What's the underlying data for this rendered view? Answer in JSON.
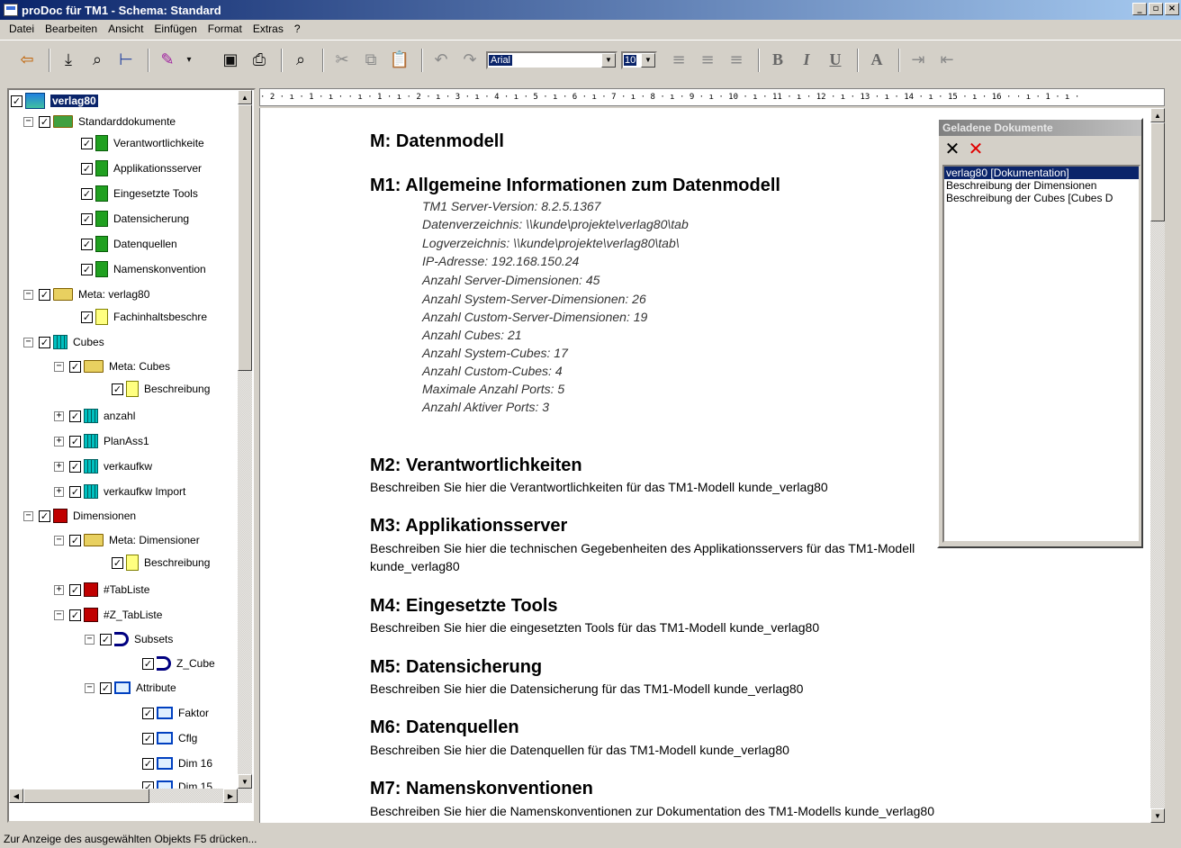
{
  "window": {
    "title": "proDoc für TM1 - Schema: Standard"
  },
  "menu": [
    "Datei",
    "Bearbeiten",
    "Ansicht",
    "Einfügen",
    "Format",
    "Extras",
    "?"
  ],
  "menu_ul": [
    "D",
    "B",
    "A",
    "E",
    "t",
    "x",
    "?"
  ],
  "toolbar": {
    "font": "Arial",
    "size": "10"
  },
  "tree": {
    "root": "verlag80",
    "standarddokumente": "Standarddokumente",
    "std_items": [
      "Verantwortlichkeite",
      "Applikationsserver",
      "Eingesetzte Tools",
      "Datensicherung",
      "Datenquellen",
      "Namenskonvention"
    ],
    "meta_verlag": "Meta: verlag80",
    "fachinhalt": "Fachinhaltsbeschre",
    "cubes": "Cubes",
    "meta_cubes": "Meta: Cubes",
    "beschreibung1": "Beschreibung",
    "cube_items": [
      "anzahl",
      "PlanAss1",
      "verkaufkw",
      "verkaufkw Import"
    ],
    "dimensionen": "Dimensionen",
    "meta_dims": "Meta: Dimensioner",
    "beschreibung2": "Beschreibung",
    "tabliste": "#TabListe",
    "z_tabliste": "#Z_TabListe",
    "subsets": "Subsets",
    "z_cube": "Z_Cube",
    "attribute": "Attribute",
    "attr_items": [
      "Faktor",
      "Cflg",
      "Dim 16",
      "Dim 15"
    ]
  },
  "ruler": "· 2 · ı · 1 · ı ·  · ı · 1 · ı · 2 · ı · 3 · ı · 4 · ı · 5 · ı · 6 · ı · 7 · ı · 8 · ı · 9 · ı · 10 · ı · 11 · ı · 12 · ı · 13 · ı · 14 · ı · 15 · ı · 16 ·   · ı · 1 · ı · ",
  "document": {
    "m": "M: Datenmodell",
    "m1": "M1: Allgemeine Informationen zum Datenmodell",
    "info": [
      "TM1 Server-Version: 8.2.5.1367",
      "Datenverzeichnis: \\\\kunde\\projekte\\verlag80\\tab",
      "Logverzeichnis: \\\\kunde\\projekte\\verlag80\\tab\\",
      "IP-Adresse: 192.168.150.24",
      "Anzahl Server-Dimensionen: 45",
      "Anzahl System-Server-Dimensionen: 26",
      "Anzahl Custom-Server-Dimensionen: 19",
      "Anzahl Cubes: 21",
      "Anzahl System-Cubes: 17",
      "Anzahl Custom-Cubes: 4",
      "Maximale Anzahl Ports: 5",
      "Anzahl Aktiver Ports: 3"
    ],
    "m2": "M2: Verantwortlichkeiten",
    "m2_text": "Beschreiben Sie hier die Verantwortlichkeiten für das TM1-Modell kunde_verlag80",
    "m3": "M3: Applikationsserver",
    "m3_text": "Beschreiben Sie hier die technischen Gegebenheiten des Applikationsservers für das TM1-Modell",
    "m3_text2": "kunde_verlag80",
    "m4": "M4: Eingesetzte Tools",
    "m4_text": "Beschreiben Sie hier die eingesetzten Tools für das TM1-Modell kunde_verlag80",
    "m5": "M5: Datensicherung",
    "m5_text": "Beschreiben Sie hier die Datensicherung für das TM1-Modell kunde_verlag80",
    "m6": "M6: Datenquellen",
    "m6_text": "Beschreiben Sie hier die Datenquellen für das TM1-Modell kunde_verlag80",
    "m7": "M7: Namenskonventionen",
    "m7_text": "Beschreiben Sie hier die Namenskonventionen zur Dokumentation des TM1-Modells kunde_verlag80"
  },
  "loaded_docs": {
    "title": "Geladene Dokumente",
    "items": [
      "verlag80       [Dokumentation]",
      "Beschreibung der Dimensionen",
      "Beschreibung der Cubes    [Cubes D"
    ]
  },
  "status": "Zur Anzeige des ausgewählten Objekts F5 drücken..."
}
